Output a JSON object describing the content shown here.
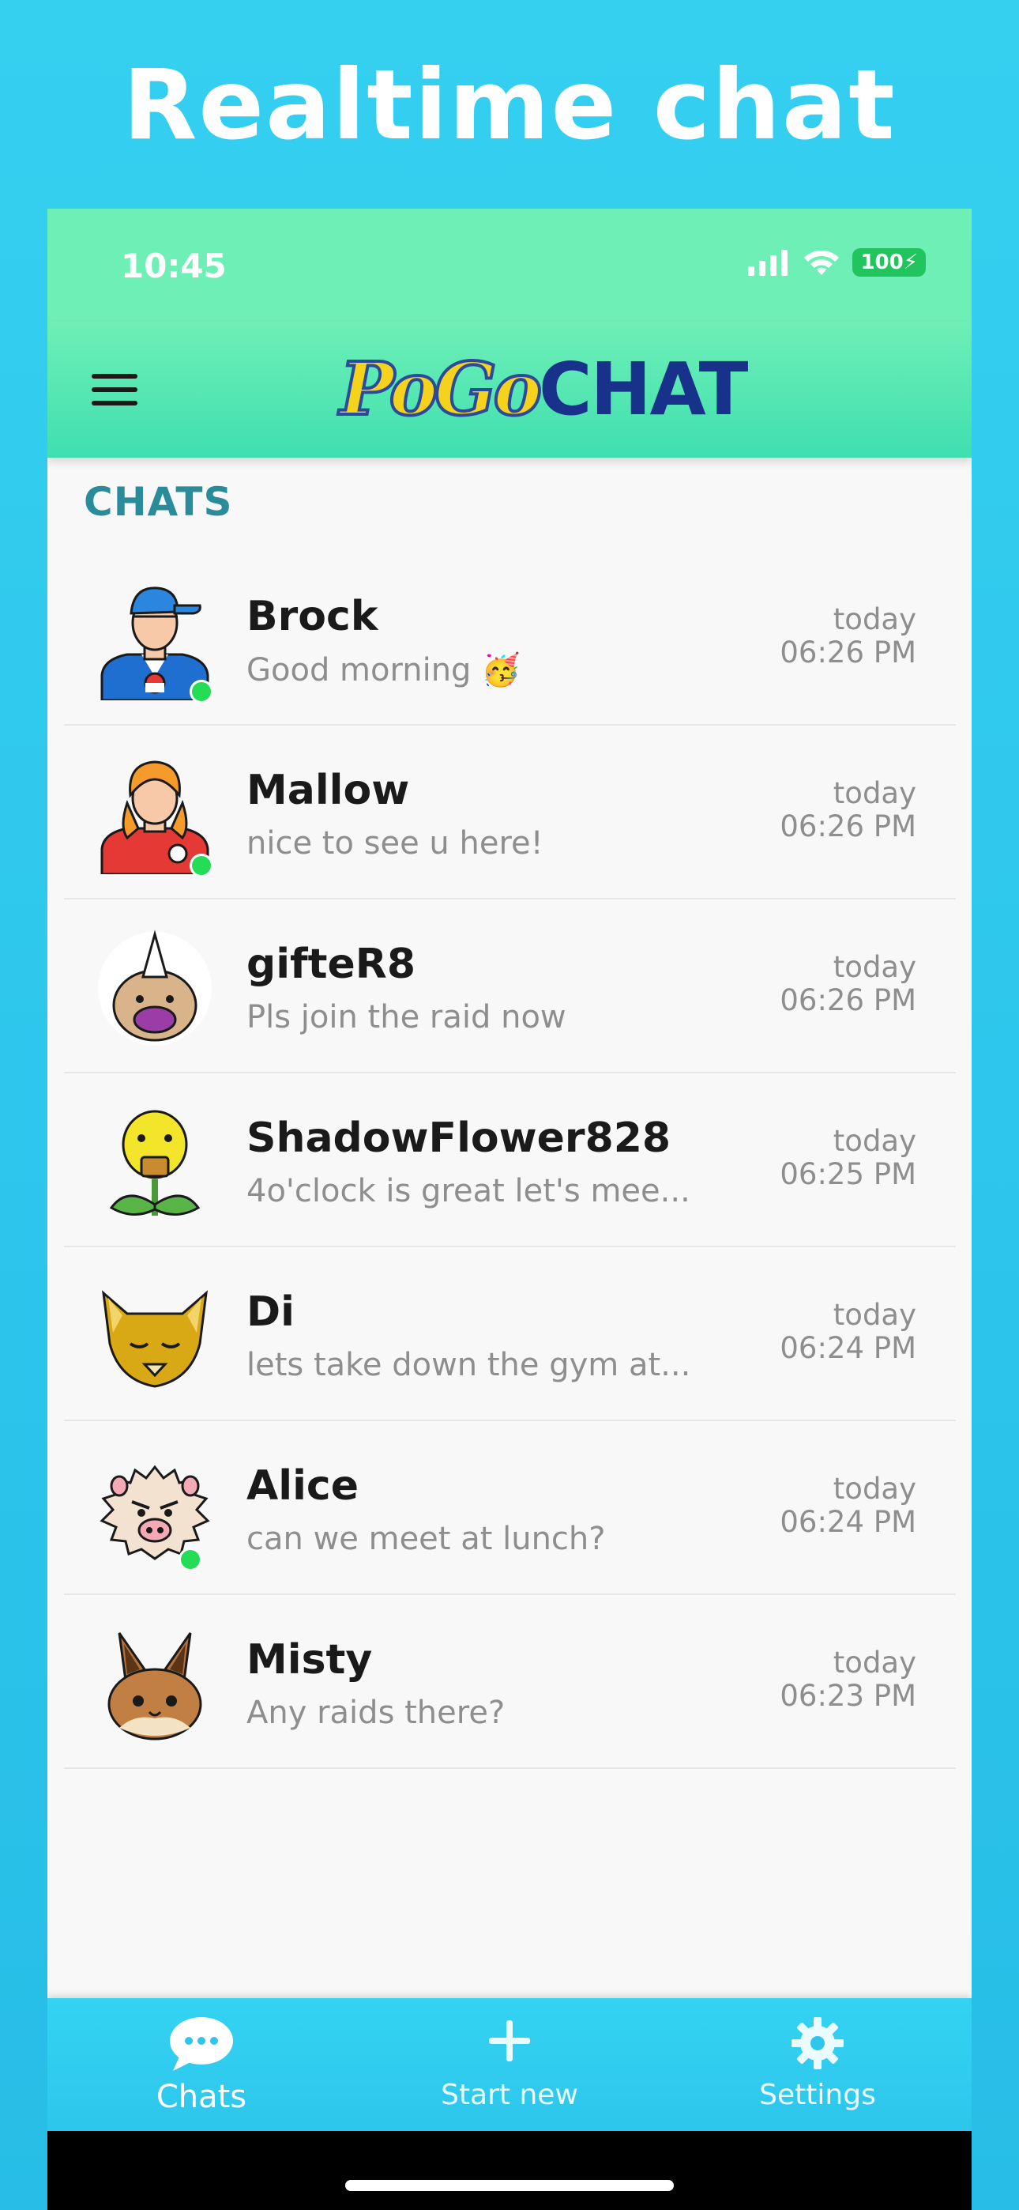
{
  "headline": "Realtime chat",
  "status_bar": {
    "time": "10:45",
    "battery": "100"
  },
  "header": {
    "logo_part1": "PoGo",
    "logo_part2": "CHAT"
  },
  "section_title": "CHATS",
  "chats": [
    {
      "name": "Brock",
      "message": "Good morning 🥳",
      "day": "today",
      "time": "06:26 PM",
      "online": true,
      "avatar": "trainer-blue-cap-avatar"
    },
    {
      "name": "Mallow",
      "message": "nice to see u here!",
      "day": "today",
      "time": "06:26 PM",
      "online": true,
      "avatar": "trainer-orange-hair-avatar"
    },
    {
      "name": "gifteR8",
      "message": "Pls join the raid now",
      "day": "today",
      "time": "06:26 PM",
      "online": false,
      "avatar": "weedle-avatar"
    },
    {
      "name": "ShadowFlower828",
      "message": "4o'clock is great let's mee...",
      "day": "today",
      "time": "06:25 PM",
      "online": false,
      "avatar": "bellsprout-avatar"
    },
    {
      "name": "Di",
      "message": "lets take down the gym at...",
      "day": "today",
      "time": "06:24 PM",
      "online": false,
      "avatar": "abra-avatar"
    },
    {
      "name": "Alice",
      "message": "can we meet at lunch?",
      "day": "today",
      "time": "06:24 PM",
      "online": true,
      "avatar": "mankey-avatar"
    },
    {
      "name": "Misty",
      "message": "Any raids there?",
      "day": "today",
      "time": "06:23 PM",
      "online": false,
      "avatar": "eevee-avatar"
    }
  ],
  "tabs": [
    {
      "label": "Chats",
      "icon": "chat-bubble-icon",
      "active": true
    },
    {
      "label": "Start new",
      "icon": "plus-icon",
      "active": false
    },
    {
      "label": "Settings",
      "icon": "gear-icon",
      "active": false
    }
  ],
  "colors": {
    "accent": "#2a8c9a",
    "header_green": "#6eefb6",
    "tab_blue": "#33d3f2",
    "online": "#22dd55"
  }
}
